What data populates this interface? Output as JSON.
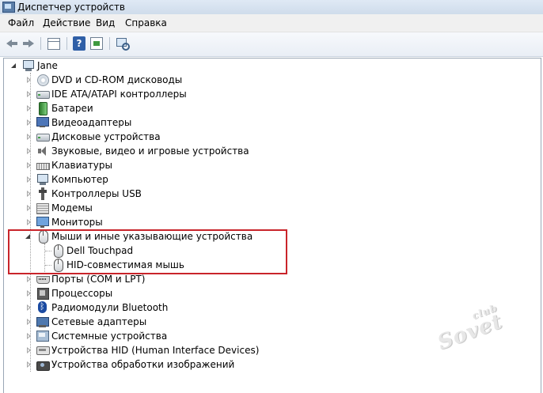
{
  "window": {
    "title": "Диспетчер устройств"
  },
  "menu": [
    {
      "label": "Файл"
    },
    {
      "label": "Действие"
    },
    {
      "label": "Вид"
    },
    {
      "label": "Справка"
    }
  ],
  "toolbar": {
    "buttons": [
      "back-icon",
      "forward-icon",
      "console-tree-icon",
      "help-icon",
      "properties-icon",
      "scan-hardware-icon"
    ]
  },
  "tree": {
    "root": "Jane",
    "categories": [
      {
        "label": "DVD и CD-ROM дисководы",
        "icon": "disc-drive-icon"
      },
      {
        "label": "IDE ATA/ATAPI контроллеры",
        "icon": "ide-controller-icon"
      },
      {
        "label": "Батареи",
        "icon": "battery-icon"
      },
      {
        "label": "Видеоадаптеры",
        "icon": "display-adapter-icon"
      },
      {
        "label": "Дисковые устройства",
        "icon": "disk-drive-icon"
      },
      {
        "label": "Звуковые, видео и игровые устройства",
        "icon": "sound-icon"
      },
      {
        "label": "Клавиатуры",
        "icon": "keyboard-icon"
      },
      {
        "label": "Компьютер",
        "icon": "computer-icon"
      },
      {
        "label": "Контроллеры USB",
        "icon": "usb-icon"
      },
      {
        "label": "Модемы",
        "icon": "modem-icon"
      },
      {
        "label": "Мониторы",
        "icon": "monitor-icon"
      },
      {
        "label": "Мыши и иные указывающие устройства",
        "icon": "mouse-icon",
        "expanded": true,
        "children": [
          {
            "label": "Dell Touchpad",
            "icon": "mouse-icon"
          },
          {
            "label": "HID-совместимая мышь",
            "icon": "mouse-icon"
          }
        ]
      },
      {
        "label": "Порты (COM и LPT)",
        "icon": "port-icon"
      },
      {
        "label": "Процессоры",
        "icon": "processor-icon"
      },
      {
        "label": "Радиомодули Bluetooth",
        "icon": "bluetooth-icon"
      },
      {
        "label": "Сетевые адаптеры",
        "icon": "network-adapter-icon"
      },
      {
        "label": "Системные устройства",
        "icon": "system-devices-icon"
      },
      {
        "label": "Устройства HID (Human Interface Devices)",
        "icon": "hid-icon"
      },
      {
        "label": "Устройства обработки изображений",
        "icon": "imaging-icon"
      }
    ]
  },
  "watermark": {
    "line1": "club",
    "line2": "Sovet"
  },
  "colors": {
    "highlight": "#c9242a",
    "title_bar": "#dfe9f5"
  }
}
